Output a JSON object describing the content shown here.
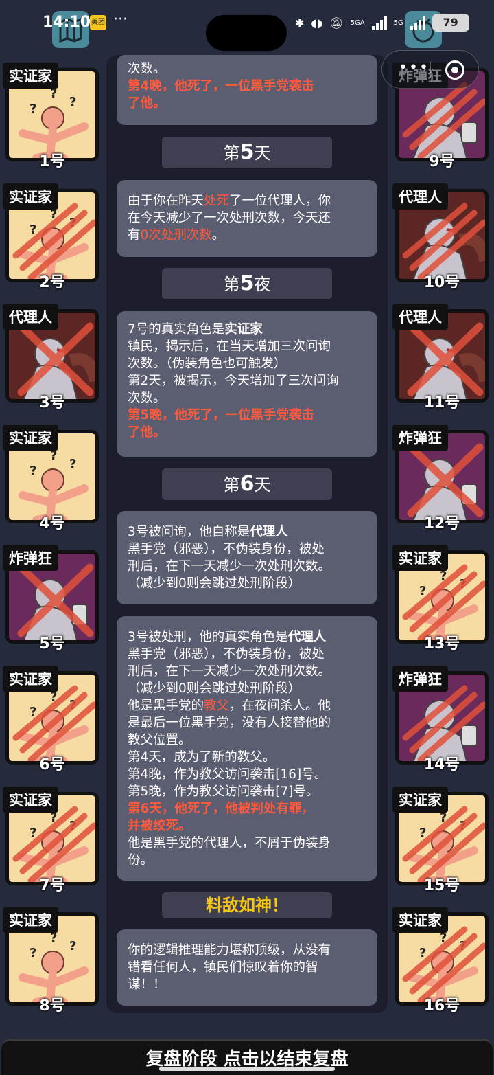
{
  "status_bar": {
    "time": "14:10",
    "badge": "美团",
    "network_a": "5GA",
    "network_b": "5G",
    "battery": "79"
  },
  "players": [
    {
      "id": "1",
      "role": "实证家",
      "num": "1号",
      "type": "emp",
      "mark": "none"
    },
    {
      "id": "2",
      "role": "实证家",
      "num": "2号",
      "type": "emp",
      "mark": "claw"
    },
    {
      "id": "3",
      "role": "代理人",
      "num": "3号",
      "type": "agent",
      "mark": "cross"
    },
    {
      "id": "4",
      "role": "实证家",
      "num": "4号",
      "type": "emp",
      "mark": "none"
    },
    {
      "id": "5",
      "role": "炸弹狂",
      "num": "5号",
      "type": "bomb",
      "mark": "cross"
    },
    {
      "id": "6",
      "role": "实证家",
      "num": "6号",
      "type": "emp",
      "mark": "claw"
    },
    {
      "id": "7",
      "role": "实证家",
      "num": "7号",
      "type": "emp",
      "mark": "claw"
    },
    {
      "id": "8",
      "role": "实证家",
      "num": "8号",
      "type": "emp",
      "mark": "none"
    },
    {
      "id": "9",
      "role": "炸弹狂",
      "num": "9号",
      "type": "bomb",
      "mark": "claw"
    },
    {
      "id": "10",
      "role": "代理人",
      "num": "10号",
      "type": "agent",
      "mark": "claw"
    },
    {
      "id": "11",
      "role": "代理人",
      "num": "11号",
      "type": "agent",
      "mark": "cross"
    },
    {
      "id": "12",
      "role": "炸弹狂",
      "num": "12号",
      "type": "bomb",
      "mark": "cross"
    },
    {
      "id": "13",
      "role": "实证家",
      "num": "13号",
      "type": "emp",
      "mark": "claw"
    },
    {
      "id": "14",
      "role": "炸弹狂",
      "num": "14号",
      "type": "bomb",
      "mark": "claw"
    },
    {
      "id": "15",
      "role": "实证家",
      "num": "15号",
      "type": "emp",
      "mark": "claw"
    },
    {
      "id": "16",
      "role": "实证家",
      "num": "16号",
      "type": "emp",
      "mark": "claw"
    }
  ],
  "log": {
    "b0": {
      "l1": "次数。",
      "l2": "第4晚，他死了，一位黑手党袭击",
      "l3": "了他。"
    },
    "day5": {
      "pre": "第",
      "n": "5",
      "post": "天"
    },
    "b1": {
      "l1a": "由于你在昨天",
      "l1b": "处死",
      "l1c": "了一位代理人，你",
      "l2": "在今天减少了一次处刑次数，今天还",
      "l3a": "有",
      "l3b": "0次处刑次数",
      "l3c": "。"
    },
    "night5": {
      "pre": "第",
      "n": "5",
      "post": "夜"
    },
    "b2": {
      "l1a": "7号的真实角色是",
      "l1b": "实证家",
      "l2": "镇民，揭示后，在当天增加三次问询",
      "l3": "次数。（伪装角色也可触发）",
      "l4": "第2天，被揭示，今天增加了三次问询",
      "l5": "次数。",
      "l6": "第5晚，他死了，一位黑手党袭击",
      "l7": "了他。"
    },
    "day6": {
      "pre": "第",
      "n": "6",
      "post": "天"
    },
    "b3": {
      "l1a": "3号被问询，他自称是",
      "l1b": "代理人",
      "l2": "黑手党（邪恶），不伪装身份，被处",
      "l3": "刑后，在下一天减少一次处刑次数。",
      "l4": "（减少到0则会跳过处刑阶段）"
    },
    "b4": {
      "l1a": "3号被处刑，他的真实角色是",
      "l1b": "代理人",
      "l2": "黑手党（邪恶），不伪装身份，被处",
      "l3": "刑后，在下一天减少一次处刑次数。",
      "l4": "（减少到0则会跳过处刑阶段）",
      "l5a": "他是黑手党的",
      "l5b": "教父",
      "l5c": "，在夜间杀人。他",
      "l6": "是最后一位黑手党，没有人接替他的",
      "l7": "教父位置。",
      "l8": "第4天，成为了新的教父。",
      "l9": "第4晚，作为教父访问袭击[16]号。",
      "l10": "第5晚，作为教父访问袭击[7]号。",
      "l11": "第6天，他死了，他被判处有罪，",
      "l12": "并被绞死。",
      "l13": "他是黑手党的代理人，不屑于伪装身",
      "l14": "份。"
    },
    "verdict": "料敌如神！",
    "b5": {
      "l1": "你的逻辑推理能力堪称顶级，从没有",
      "l2": "错看任何人，镇民们惊叹着你的智",
      "l3": "谋！！"
    }
  },
  "bottom_bar": "复盘阶段 点击以结束复盘",
  "colors": {
    "background": "#262a3d",
    "bubble": "#5b5d70",
    "highlight": "#ff5a3d",
    "gold": "#f5c518"
  }
}
